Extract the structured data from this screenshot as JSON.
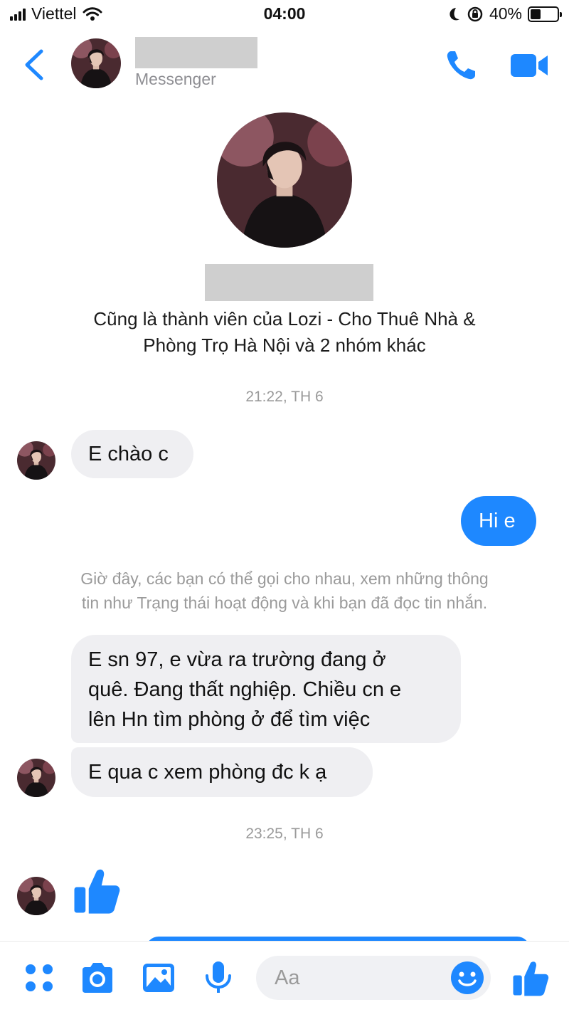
{
  "status_bar": {
    "carrier": "Viettel",
    "time": "04:00",
    "battery_percent": "40%",
    "battery_level": 0.4,
    "icons": [
      "signal-bars",
      "wifi",
      "moon",
      "orientation-lock",
      "battery"
    ]
  },
  "header": {
    "subtitle": "Messenger",
    "icons": [
      "back-chevron",
      "phone",
      "video-camera"
    ]
  },
  "profile": {
    "info_line1": "Cũng là thành viên của Lozi - Cho Thuê Nhà &",
    "info_line2": "Phòng Trọ Hà Nội và 2 nhóm khác"
  },
  "conversation": {
    "timestamp_1": "21:22, TH 6",
    "msg_1": "E chào c",
    "msg_2": "Hi e",
    "system_line1": "Giờ đây, các bạn có thể gọi cho nhau, xem những thông",
    "system_line2": "tin như Trạng thái hoạt động và khi bạn đã đọc tin nhắn.",
    "msg_3_line1": "E sn 97, e vừa ra trường đang ở",
    "msg_3_line2": "quê. Đang thất nghiệp. Chiều cn e",
    "msg_3_line3": "lên Hn tìm phòng ở để tìm việc",
    "msg_4": "E qua c xem phòng đc k ạ",
    "timestamp_2": "23:25, TH 6",
    "sticker": "thumbs-up"
  },
  "composer": {
    "placeholder": "Aa",
    "icons": [
      "apps-grid",
      "camera",
      "image",
      "microphone",
      "emoji",
      "thumbs-up"
    ]
  },
  "colors": {
    "accent": "#1e88ff",
    "incoming_bubble": "#efeff2",
    "meta_text": "#9a9a9a",
    "redaction": "#cfcfcf"
  }
}
